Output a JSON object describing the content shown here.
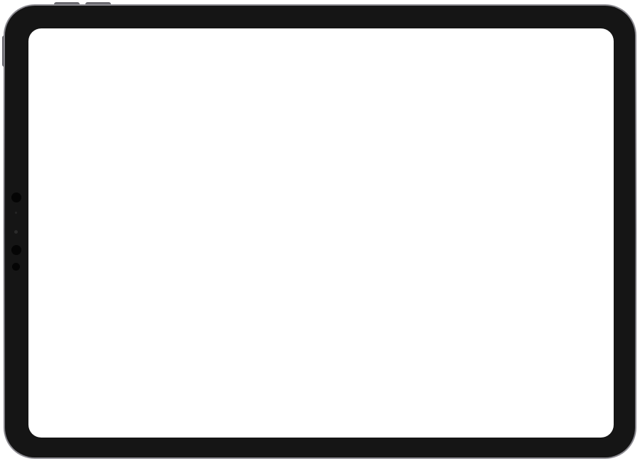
{
  "device": {
    "type": "tablet",
    "orientation": "landscape",
    "frame_color": "#151515",
    "screen_color": "#ffffff"
  },
  "screen": {
    "content": ""
  }
}
